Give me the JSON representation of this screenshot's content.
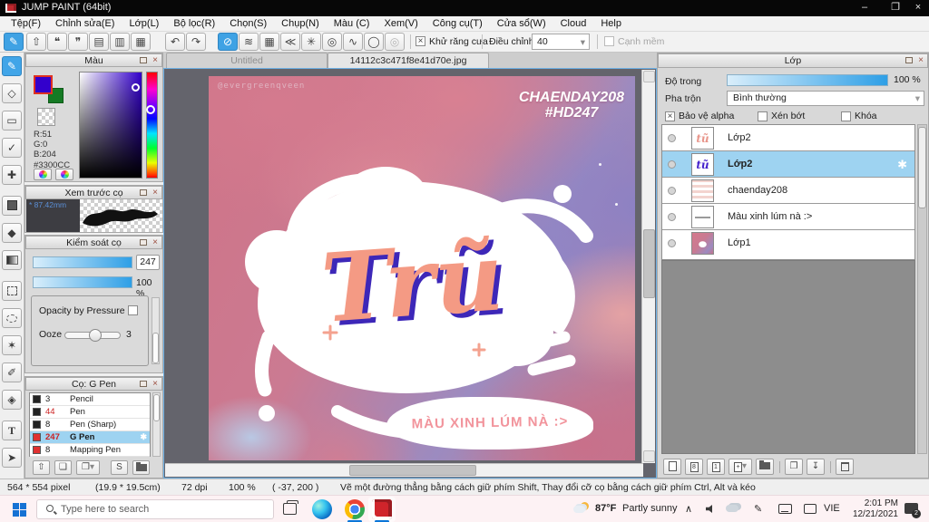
{
  "window": {
    "title": "JUMP PAINT (64bit)"
  },
  "icons": {
    "minimize": "–",
    "restore": "❐",
    "close": "×",
    "check": "×",
    "brush": "✎",
    "upload": "⇧",
    "comment": "❝",
    "comments": "❞",
    "document": "▤",
    "material": "▥",
    "windows": "▦",
    "undo": "↶",
    "redo": "↷",
    "snap_off": "⊘",
    "snap_parallel": "≋",
    "snap_grid": "▦",
    "snap_vanish": "≪",
    "snap_radial": "✳",
    "snap_concentric": "◎",
    "snap_curve": "∿",
    "snap_ellipse": "◯",
    "snap_custom": "◎",
    "eraser": "◇",
    "shape_rect": "▭",
    "polyline": "✓",
    "move": "✚",
    "bucket": "◆",
    "wand": "✶",
    "select_pen": "✐",
    "select_eraser": "◈",
    "text_tool": "T",
    "operate": "➤",
    "dropdown": "▾",
    "gear": "✱",
    "panel_close": "×",
    "new_page": "❏",
    "duplicate": "❐",
    "merge": "↧",
    "letter_s": "S",
    "chevron_up": "∧",
    "pen_tray": "✎",
    "plus_8": "8",
    "plus_1": "1",
    "plus": "+"
  },
  "menu": {
    "items": [
      "Tệp(F)",
      "Chỉnh sửa(E)",
      "Lớp(L)",
      "Bộ lọc(R)",
      "Chọn(S)",
      "Chụp(N)",
      "Màu (C)",
      "Xem(V)",
      "Công cụ(T)",
      "Cửa sổ(W)",
      "Cloud",
      "Help"
    ]
  },
  "toolbar": {
    "antialias_label": "Khử răng cưa",
    "adjust_label": "Điều chỉnh",
    "adjust_value": "40",
    "soft_edge_label": "Cạnh mềm"
  },
  "tabs": {
    "untitled": "Untitled",
    "file": "14112c3c471f8e41d70e.jpg"
  },
  "color_panel": {
    "title": "Màu",
    "r": "R:51",
    "g": "G:0",
    "b": "B:204",
    "hex": "#3300CC",
    "primary_color": "#3300CC",
    "secondary_color": "#157A24"
  },
  "brush_preview": {
    "title": "Xem trước cọ",
    "size_label": "* 87.42mm"
  },
  "brush_control": {
    "title": "Kiểm soát cọ",
    "size_value": "247",
    "opacity_value": "100 %",
    "pressure_label": "Opacity by Pressure",
    "ooze_label": "Ooze",
    "ooze_value": "3"
  },
  "brush_list": {
    "title": "Cọ: G Pen",
    "items": [
      {
        "size": "3",
        "name": "Pencil"
      },
      {
        "size": "44",
        "name": "Pen"
      },
      {
        "size": "8",
        "name": "Pen (Sharp)"
      },
      {
        "size": "247",
        "name": "G Pen"
      },
      {
        "size": "8",
        "name": "Mapping Pen"
      }
    ]
  },
  "canvas": {
    "watermark": "@evergreenqveen",
    "credit_line1": "CHAENDAY208",
    "credit_line2": "#HD247",
    "title_word": "Trũ",
    "thumb_word": "tũ",
    "caption": "MÀU XINH LÚM NÀ :>"
  },
  "layers_panel": {
    "title": "Lớp",
    "opacity_label": "Độ trong",
    "opacity_value": "100 %",
    "blend_label": "Pha trộn",
    "blend_value": "Bình thường",
    "chk_alpha": "Bảo vệ alpha",
    "chk_clip": "Xén bớt",
    "chk_lock": "Khóa",
    "layers": [
      {
        "name": "Lớp2"
      },
      {
        "name": "Lớp2"
      },
      {
        "name": "chaenday208"
      },
      {
        "name": "Màu xinh lúm nà :>"
      },
      {
        "name": "Lớp1"
      }
    ]
  },
  "status_bar": {
    "dimensions": "564 * 554 pixel",
    "size_cm": "(19.9 * 19.5cm)",
    "dpi": "72 dpi",
    "zoom": "100 %",
    "coords": "( -37, 200 )",
    "hint": "Vẽ một đường thẳng bằng cách giữ phím Shift, Thay đổi cỡ cọ bằng cách giữ phím Ctrl, Alt và kéo"
  },
  "taskbar": {
    "search_placeholder": "Type here to search",
    "weather_temp": "87°F",
    "weather_desc": "Partly sunny",
    "language": "VIE",
    "time": "2:01 PM",
    "date": "12/21/2021",
    "notification_count": "2"
  }
}
